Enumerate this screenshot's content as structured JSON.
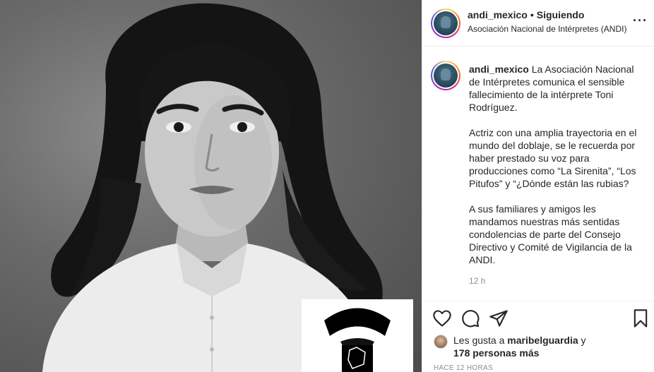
{
  "header": {
    "username": "andi_mexico",
    "separator": "•",
    "follow_status": "Siguiendo",
    "subtitle": "Asociación Nacional de Intérpretes (ANDI)",
    "more_icon": "more-horizontal-icon",
    "more_glyph": "···"
  },
  "caption": {
    "username": "andi_mexico",
    "paragraph1": "La Asociación Nacional de Intérpretes comunica el sensible fallecimiento de la intérprete Toni Rodríguez.",
    "paragraph2": "Actriz con una amplia trayectoria en el mundo del doblaje, se le recuerda por haber prestado su voz para producciones como “La Sirenita”, “Los Pitufos” y “¿Dónde están las rubias?",
    "paragraph3": "A sus familiares y amigos les mandamos nuestras más sentidas condolencias de parte del Consejo Directivo y Comité de Vigilancia de la ANDI.",
    "time": "12 h"
  },
  "actions": {
    "icons": [
      "heart-icon",
      "comment-icon",
      "share-icon",
      "bookmark-icon"
    ]
  },
  "likes": {
    "prefix": "Les gusta a",
    "user": "maribelguardia",
    "joiner": "y",
    "others": "178 personas más"
  },
  "timestamp": "HACE 12 HORAS",
  "colors": {
    "text": "#262626",
    "secondary": "#8e8e8e",
    "divider": "#efefef"
  }
}
